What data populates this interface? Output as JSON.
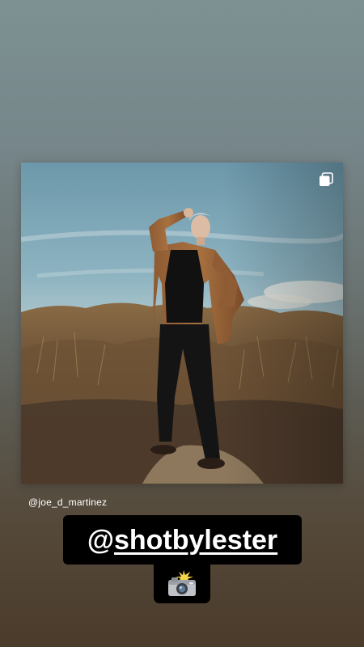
{
  "story": {
    "post": {
      "image_alt": "Man in camel coat standing in dry grassland under blue sky",
      "multi_photo_icon": "carousel-icon"
    },
    "author_handle": "@joe_d_martinez",
    "mention": {
      "at": "@",
      "handle": "shotbylester"
    },
    "emoji": {
      "name": "camera-with-flash-icon"
    }
  }
}
